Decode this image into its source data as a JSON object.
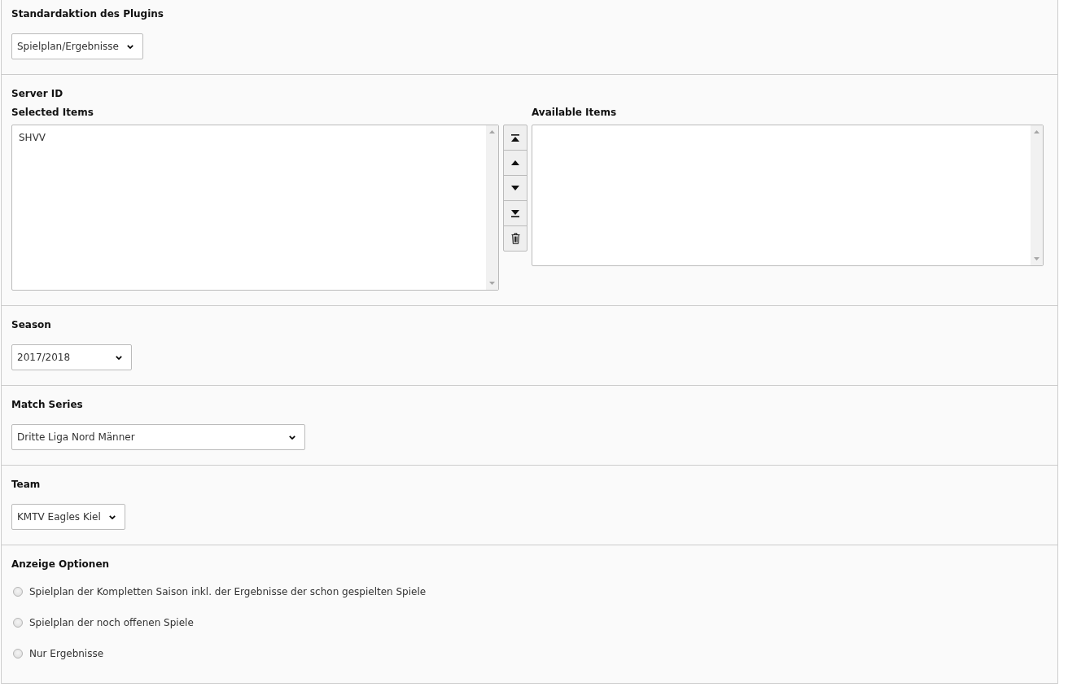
{
  "sections": [
    {
      "kind": "select",
      "label": "Standardaktion des Plugins",
      "value": "Spielplan/Ergebnisse"
    },
    {
      "kind": "dual_list",
      "label": "Server ID",
      "selected_list": {
        "label": "Selected Items",
        "items": [
          {
            "text": "SHVV",
            "selected": false
          }
        ]
      },
      "available_list": {
        "label": "Available Items"
      }
    },
    {
      "kind": "select",
      "label": "Season",
      "value": "2017/2018"
    },
    {
      "kind": "select",
      "label": "Match Series",
      "value": "Dritte Liga Nord Männer"
    },
    {
      "kind": "select",
      "label": "Team",
      "value": "KMTV Eagles Kiel"
    },
    {
      "kind": "radio_group",
      "label": "Anzeige Optionen",
      "options": [
        {
          "label": "Spielplan der Kompletten Saison inkl. der Ergebnisse der schon gespielten Spiele",
          "selected": false
        },
        {
          "label": "Spielplan der noch offenen Spiele",
          "selected": false
        },
        {
          "label": "Nur Ergebnisse",
          "selected": false
        }
      ]
    }
  ]
}
